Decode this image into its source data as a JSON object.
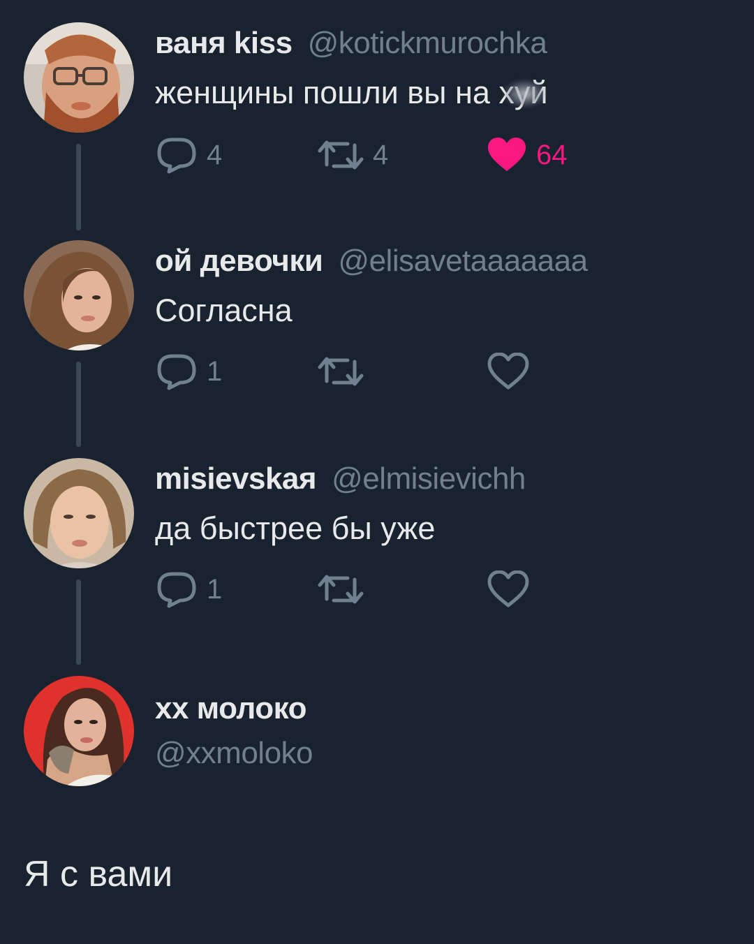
{
  "thread": [
    {
      "name": "ваня kiss",
      "handle": "@kotickmurochka",
      "text": "женщины пошли вы на х",
      "text_tail": "уй",
      "replies": "4",
      "retweets": "4",
      "likes": "64",
      "liked": true,
      "avatar": "man-with-glasses-avatar"
    },
    {
      "name": "ой девочки",
      "handle": "@elisavetaaaaaaa",
      "text": "Согласна",
      "replies": "1",
      "retweets": "",
      "likes": "",
      "liked": false,
      "avatar": "woman-long-hair-avatar"
    },
    {
      "name": "misievskaя",
      "handle": "@elmisievichh",
      "text": "да быстрее бы уже",
      "replies": "1",
      "retweets": "",
      "likes": "",
      "liked": false,
      "avatar": "woman-short-hair-avatar"
    }
  ],
  "compose": {
    "name": "xx молоко",
    "handle": "@xxmoloko",
    "text": "Я с вами",
    "avatar": "woman-red-background-avatar"
  },
  "colors": {
    "background": "#19222f",
    "primary_text": "#e7e9ea",
    "secondary_text": "#71808f",
    "like_pink": "#f91880",
    "thread_line": "#3b4756"
  },
  "icons": {
    "reply": "reply-icon",
    "retweet": "retweet-icon",
    "like": "heart-icon"
  }
}
